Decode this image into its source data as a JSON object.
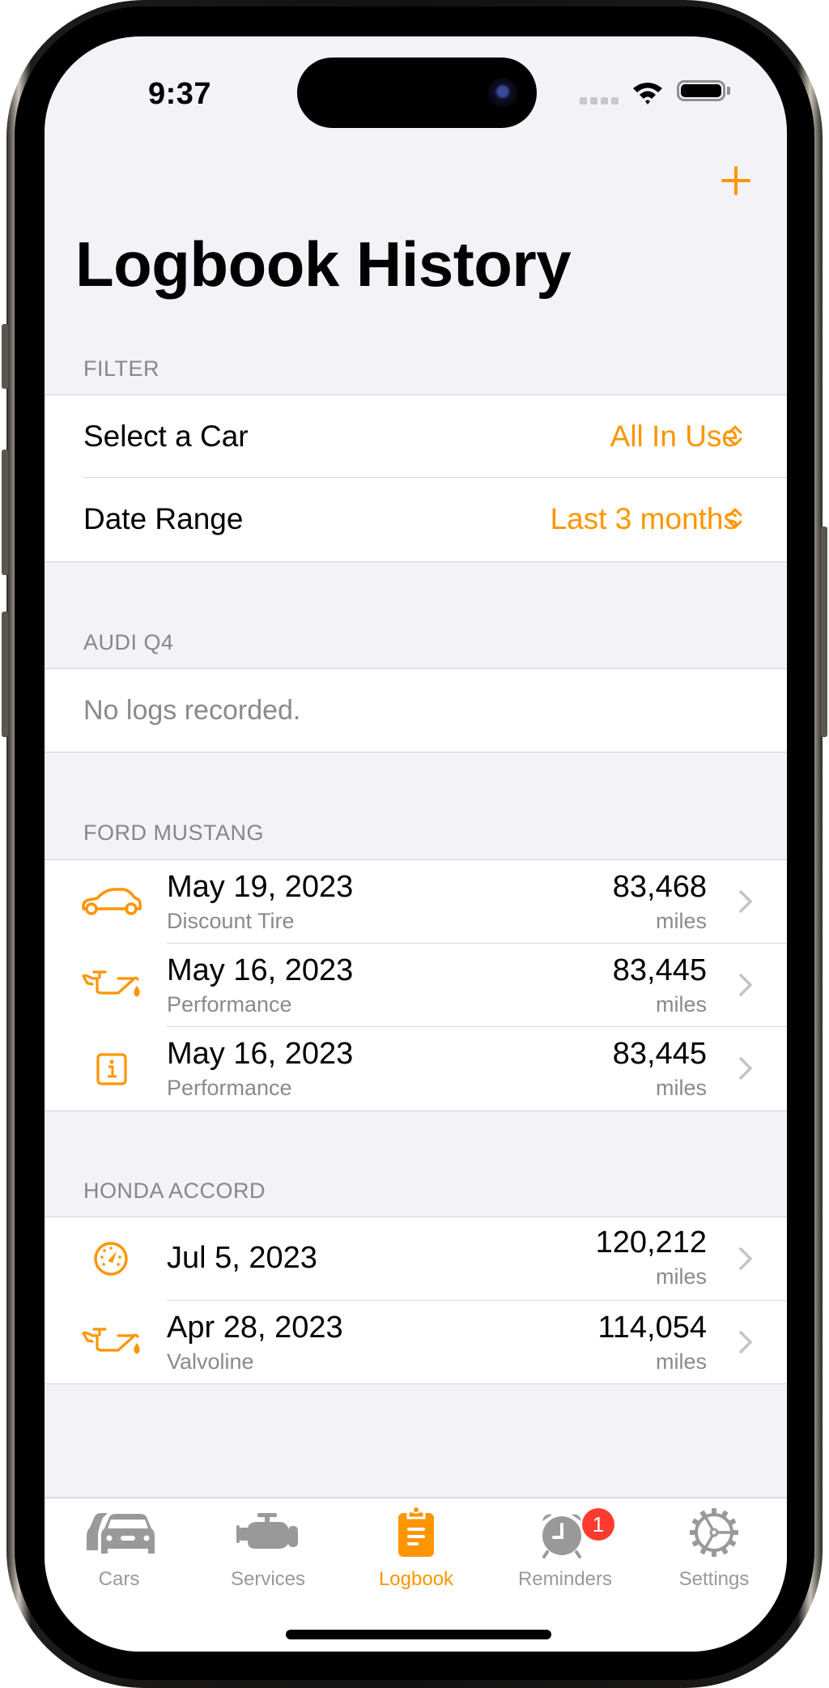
{
  "status_bar": {
    "time": "9:37",
    "icons": [
      "signal-icon",
      "wifi-icon",
      "battery-icon"
    ]
  },
  "nav": {
    "add_button_icon": "plus-icon",
    "title": "Logbook History"
  },
  "filter": {
    "header": "FILTER",
    "rows": [
      {
        "label": "Select a Car",
        "value": "All In Use",
        "icon": "chevron-up-down-icon"
      },
      {
        "label": "Date Range",
        "value": "Last 3 months",
        "icon": "chevron-up-down-icon"
      }
    ]
  },
  "sections": [
    {
      "header": "AUDI Q4",
      "empty_text": "No logs recorded.",
      "entries": []
    },
    {
      "header": "FORD MUSTANG",
      "entries": [
        {
          "icon": "car-icon",
          "date": "May 19, 2023",
          "subtitle": "Discount Tire",
          "mileage": "83,468",
          "unit": "miles"
        },
        {
          "icon": "oil-can-icon",
          "date": "May 16, 2023",
          "subtitle": "Performance",
          "mileage": "83,445",
          "unit": "miles"
        },
        {
          "icon": "info-icon",
          "date": "May 16, 2023",
          "subtitle": "Performance",
          "mileage": "83,445",
          "unit": "miles"
        }
      ]
    },
    {
      "header": "HONDA ACCORD",
      "entries": [
        {
          "icon": "gauge-icon",
          "date": "Jul 5, 2023",
          "subtitle": "",
          "mileage": "120,212",
          "unit": "miles"
        },
        {
          "icon": "oil-can-icon",
          "date": "Apr 28, 2023",
          "subtitle": "Valvoline",
          "mileage": "114,054",
          "unit": "miles"
        }
      ]
    }
  ],
  "tab_bar": {
    "active": "Logbook",
    "tabs": [
      {
        "label": "Cars",
        "icon": "cars-icon"
      },
      {
        "label": "Services",
        "icon": "engine-icon"
      },
      {
        "label": "Logbook",
        "icon": "clipboard-icon"
      },
      {
        "label": "Reminders",
        "icon": "alarm-clock-icon",
        "badge": "1"
      },
      {
        "label": "Settings",
        "icon": "gear-icon"
      }
    ]
  },
  "colors": {
    "accent": "#ff9500",
    "background": "#f2f2f7",
    "badge": "#ff3b30",
    "inactive_tab": "#999999",
    "secondary_text": "#8a8a8e"
  }
}
